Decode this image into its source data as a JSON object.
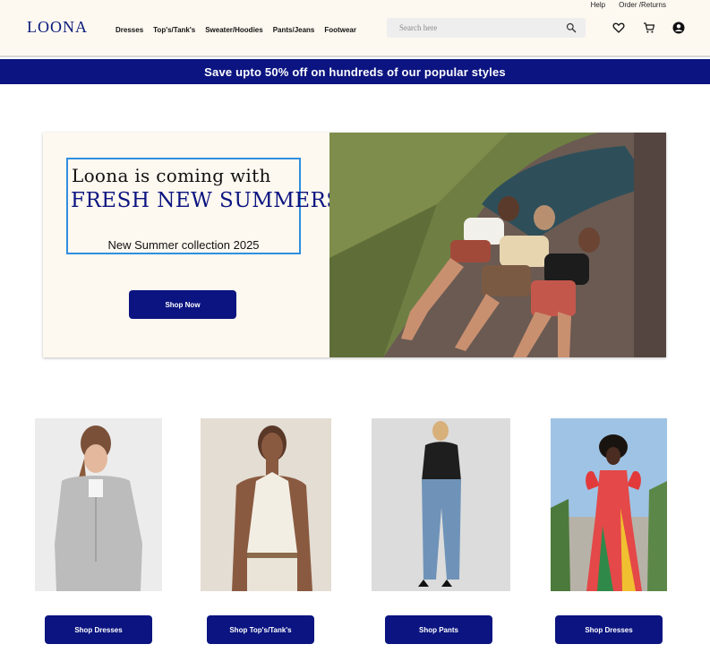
{
  "header": {
    "logo": "LOONA",
    "util_links": [
      "Help",
      "Order /Returns"
    ],
    "nav": [
      "Dresses",
      "Top's/Tank's",
      "Sweater/Hoodies",
      "Pants/Jeans",
      "Footwear"
    ],
    "search_placeholder": "Search here",
    "icons": [
      "heart-icon",
      "cart-icon",
      "account-icon"
    ]
  },
  "promo": {
    "text": "Save upto 50%  off on hundreds of our popular styles",
    "bg_color": "#0b1480"
  },
  "hero": {
    "line1": "Loona is coming with",
    "line2": "FRESH NEW SUMMERS",
    "line3": "New Summer collection 2025",
    "button": "Shop Now"
  },
  "products": [
    {
      "button": "Shop Dresses"
    },
    {
      "button": "Shop Top's/Tank's"
    },
    {
      "button": "Shop Pants"
    },
    {
      "button": "Shop Dresses"
    }
  ],
  "colors": {
    "brand": "#0b1480",
    "header_bg": "#fdf8f0",
    "highlight_border": "#2f8fe0"
  }
}
